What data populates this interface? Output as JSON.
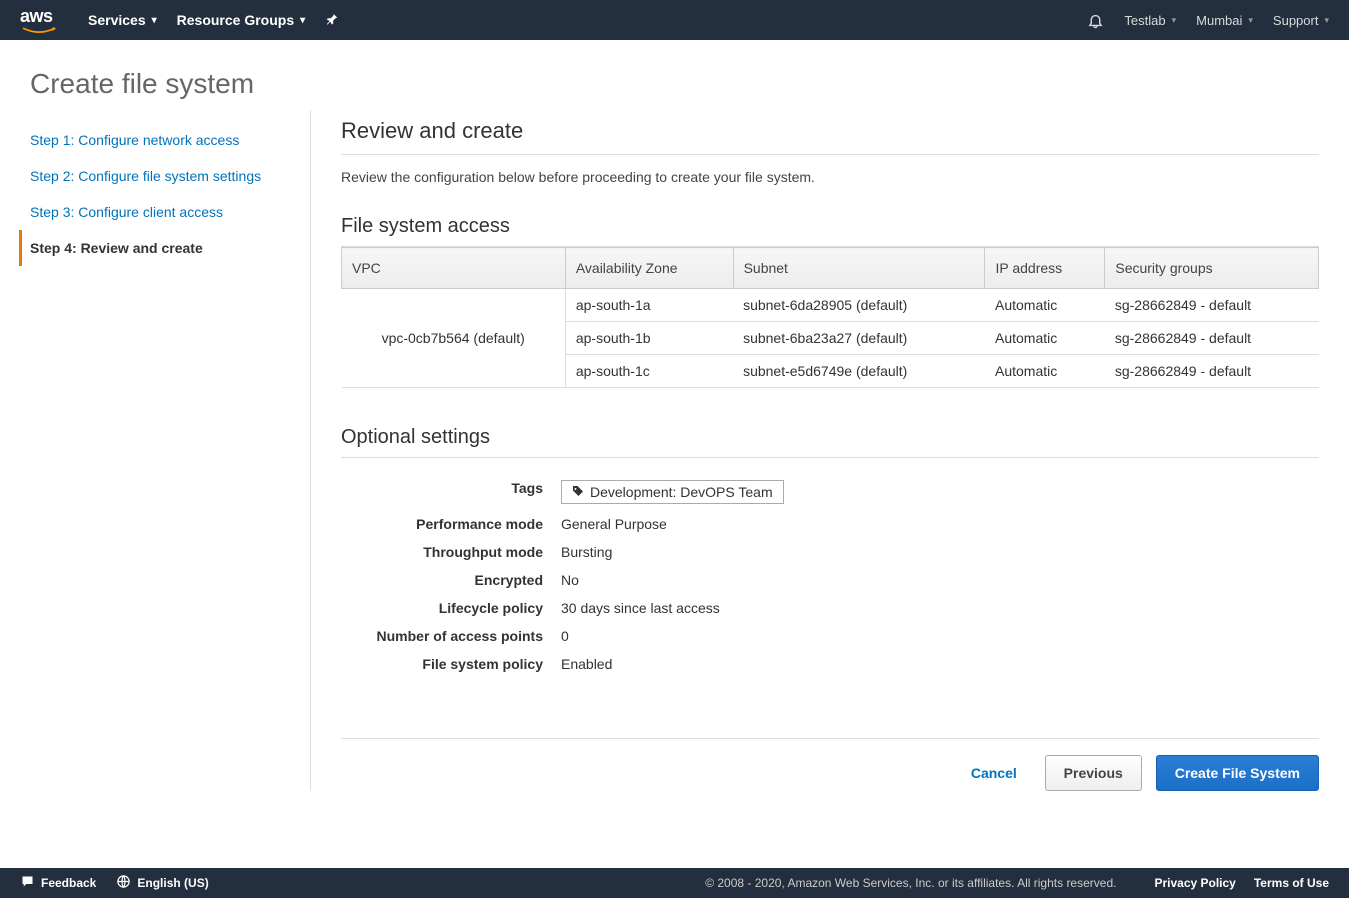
{
  "topnav": {
    "services": "Services",
    "resource_groups": "Resource Groups",
    "account": "Testlab",
    "region": "Mumbai",
    "support": "Support"
  },
  "page_title": "Create file system",
  "steps": [
    {
      "label": "Step 1: Configure network access"
    },
    {
      "label": "Step 2: Configure file system settings"
    },
    {
      "label": "Step 3: Configure client access"
    },
    {
      "label": "Step 4: Review and create"
    }
  ],
  "review": {
    "title": "Review and create",
    "desc": "Review the configuration below before proceeding to create your file system."
  },
  "fs_access": {
    "title": "File system access",
    "headers": {
      "vpc": "VPC",
      "az": "Availability Zone",
      "subnet": "Subnet",
      "ip": "IP address",
      "sg": "Security groups"
    },
    "vpc": "vpc-0cb7b564 (default)",
    "rows": [
      {
        "az": "ap-south-1a",
        "subnet": "subnet-6da28905 (default)",
        "ip": "Automatic",
        "sg": "sg-28662849 - default"
      },
      {
        "az": "ap-south-1b",
        "subnet": "subnet-6ba23a27 (default)",
        "ip": "Automatic",
        "sg": "sg-28662849 - default"
      },
      {
        "az": "ap-south-1c",
        "subnet": "subnet-e5d6749e (default)",
        "ip": "Automatic",
        "sg": "sg-28662849 - default"
      }
    ]
  },
  "optional": {
    "title": "Optional settings",
    "tags_label": "Tags",
    "tags_value": "Development: DevOPS Team",
    "perf_label": "Performance mode",
    "perf_value": "General Purpose",
    "tput_label": "Throughput mode",
    "tput_value": "Bursting",
    "enc_label": "Encrypted",
    "enc_value": "No",
    "lc_label": "Lifecycle policy",
    "lc_value": "30 days since last access",
    "ap_label": "Number of access points",
    "ap_value": "0",
    "pol_label": "File system policy",
    "pol_value": "Enabled"
  },
  "actions": {
    "cancel": "Cancel",
    "previous": "Previous",
    "create": "Create File System"
  },
  "bottombar": {
    "feedback": "Feedback",
    "language": "English (US)",
    "copyright": "© 2008 - 2020, Amazon Web Services, Inc. or its affiliates. All rights reserved.",
    "privacy": "Privacy Policy",
    "terms": "Terms of Use"
  }
}
